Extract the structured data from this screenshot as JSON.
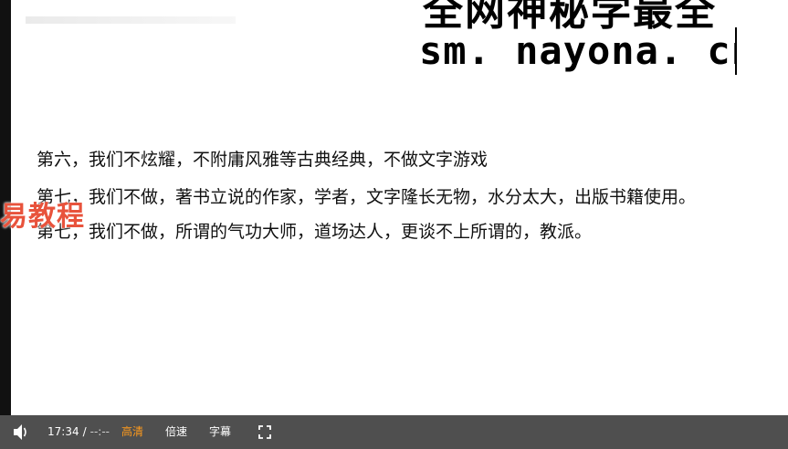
{
  "watermark": {
    "line1": "全网神秘学最全",
    "line2": "sm. nayona. cn"
  },
  "content": {
    "line1": "第六，我们不炫耀，不附庸风雅等古典经典，不做文字游戏",
    "line2": "第七，我们不做，著书立说的作家，学者，文字隆长无物，水分太大，出版书籍使用。",
    "line3": "第七，我们不做，所谓的气功大师，道场达人，更谈不上所谓的，教派。"
  },
  "overlay": {
    "stamp_text": "易教程"
  },
  "player": {
    "current_time": "17:34",
    "separator": "/",
    "duration": "--:--",
    "quality_label": "高清",
    "speed_label": "倍速",
    "subtitle_label": "字幕",
    "icons": {
      "volume": "volume-icon",
      "fullscreen": "fullscreen-icon"
    },
    "colors": {
      "bar_bg": "#4f4f4f",
      "quality_active": "#ff9b1c"
    }
  }
}
